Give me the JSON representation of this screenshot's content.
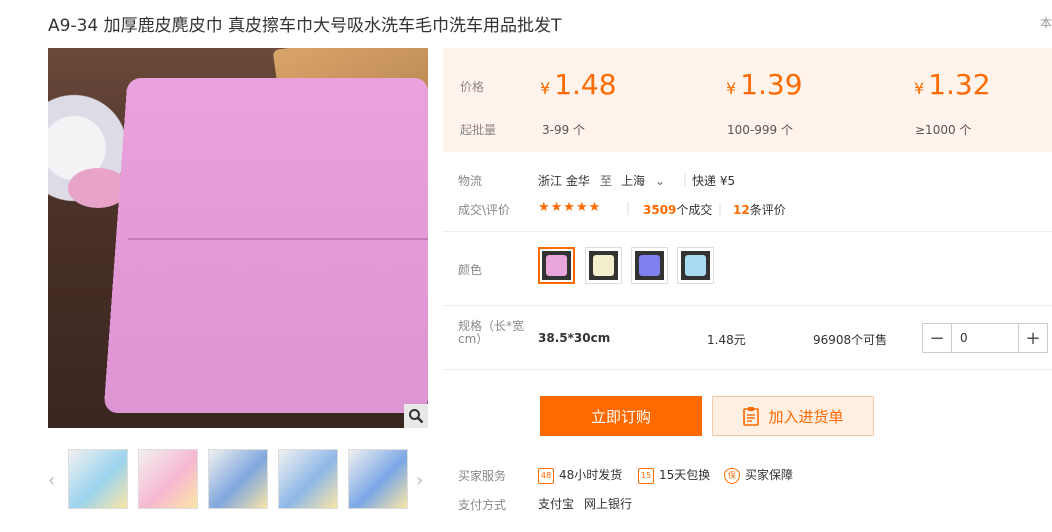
{
  "product": {
    "title": "A9-34 加厚鹿皮麂皮巾 真皮擦车巾大号吸水洗车毛巾洗车用品批发T",
    "corner_text": "本"
  },
  "price_tiers": {
    "price_label": "价格",
    "moq_label": "起批量",
    "currency": "¥",
    "tiers": [
      {
        "price": "1.48",
        "qty": "3-99 个"
      },
      {
        "price": "1.39",
        "qty": "100-999 个"
      },
      {
        "price": "1.32",
        "qty": "≥1000 个"
      }
    ]
  },
  "logistics": {
    "label": "物流",
    "from": "浙江 金华",
    "to_word": "至",
    "dest": "上海",
    "shipping": "快递 ¥5"
  },
  "deals": {
    "label": "成交\\评价",
    "stars": "★★★★★",
    "deals_count": "3509",
    "deals_suffix": "个成交",
    "reviews_count": "12",
    "reviews_suffix": "条评价"
  },
  "color": {
    "label": "颜色",
    "swatches": [
      "#e9a6dc",
      "#f3eecb",
      "#7f7ff0",
      "#a8dcf2"
    ]
  },
  "spec": {
    "label": "规格（长*宽cm）",
    "name": "38.5*30cm",
    "price": "1.48元",
    "stock": "96908个可售",
    "qty_value": "0",
    "minus": "−",
    "plus": "+"
  },
  "actions": {
    "buy_label": "立即订购",
    "cart_label": "加入进货单"
  },
  "services": {
    "label": "买家服务",
    "items": [
      {
        "icon": "48",
        "text": "48小时发货"
      },
      {
        "icon": "15",
        "text": "15天包换"
      },
      {
        "icon": "保",
        "text": "买家保障"
      }
    ]
  },
  "payment": {
    "label": "支付方式",
    "methods": [
      "支付宝",
      "网上银行"
    ]
  },
  "gallery": {
    "thumb_colors": [
      "#9bd3ef",
      "#f6b7d2",
      "#7fa6dd",
      "#8eb8e8",
      "#7aa7e6"
    ]
  },
  "colors": {
    "accent": "#ff6a00",
    "price_bg": "#fff3eb"
  }
}
